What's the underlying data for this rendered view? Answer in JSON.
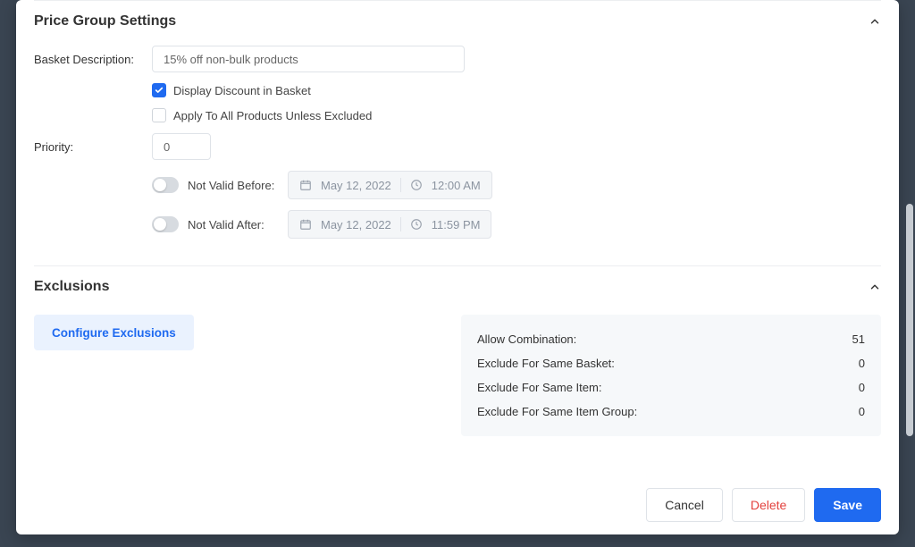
{
  "section1": {
    "title": "Price Group Settings"
  },
  "basket": {
    "label": "Basket Description:",
    "value": "15% off non-bulk products",
    "displayDiscount": {
      "label": "Display Discount in Basket",
      "checked": true
    },
    "applyAll": {
      "label": "Apply To All Products Unless Excluded",
      "checked": false
    }
  },
  "priority": {
    "label": "Priority:",
    "value": "0"
  },
  "validBefore": {
    "label": "Not Valid Before:",
    "date": "May 12, 2022",
    "time": "12:00 AM"
  },
  "validAfter": {
    "label": "Not Valid After:",
    "date": "May 12, 2022",
    "time": "11:59 PM"
  },
  "section2": {
    "title": "Exclusions"
  },
  "configureExclusions": "Configure Exclusions",
  "stats": {
    "allowCombination": {
      "label": "Allow Combination:",
      "value": "51"
    },
    "excludeSameBasket": {
      "label": "Exclude For Same Basket:",
      "value": "0"
    },
    "excludeSameItem": {
      "label": "Exclude For Same Item:",
      "value": "0"
    },
    "excludeSameGroup": {
      "label": "Exclude For Same Item Group:",
      "value": "0"
    }
  },
  "buttons": {
    "cancel": "Cancel",
    "delete": "Delete",
    "save": "Save"
  }
}
